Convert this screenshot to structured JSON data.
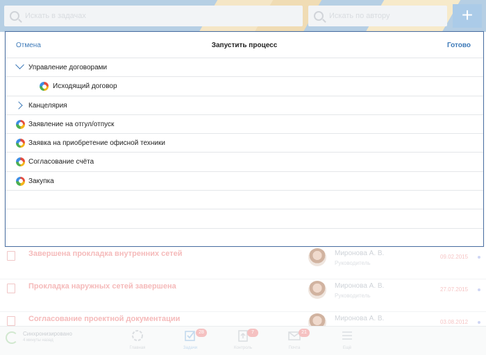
{
  "topbar": {
    "search_placeholder": "Искать в задачах",
    "filter_placeholder": "Искать по автору",
    "add_label": "+"
  },
  "modal": {
    "cancel_label": "Отмена",
    "title": "Запустить процесс",
    "done_label": "Готово",
    "items": [
      {
        "label": "Управление договорами",
        "kind": "group-expanded",
        "icon": "chevron-down-icon"
      },
      {
        "label": "Исходящий договор",
        "kind": "process",
        "icon": "process-ring-icon"
      },
      {
        "label": "Канцелярия",
        "kind": "group-collapsed",
        "icon": "chevron-right-icon"
      },
      {
        "label": "Заявление на отгул/отпуск",
        "kind": "process",
        "icon": "process-ring-icon"
      },
      {
        "label": "Заявка на приобретение офисной техники",
        "kind": "process",
        "icon": "process-ring-icon"
      },
      {
        "label": "Согласование счёта",
        "kind": "process",
        "icon": "process-ring-icon"
      },
      {
        "label": "Закупка",
        "kind": "process",
        "icon": "process-ring-icon"
      }
    ]
  },
  "tasks": [
    {
      "title": "Завершена прокладка внутренних сетей",
      "person": "Миронова А. В.",
      "role": "Руководитель",
      "date": "09.02.2015"
    },
    {
      "title": "Прокладка наружных сетей завершена",
      "person": "Миронова А. В.",
      "role": "Руководитель",
      "date": "27.07.2015"
    },
    {
      "title": "Согласование проектной документации",
      "person": "Миронова А. В.",
      "role": "Руководитель",
      "date": "03.08.2012"
    }
  ],
  "tabbar": {
    "sync_title": "Синхронизировано",
    "sync_subtitle": "4 минуты назад",
    "tabs": [
      {
        "label": "Главная",
        "badge": ""
      },
      {
        "label": "Задачи",
        "badge": "28"
      },
      {
        "label": "Контроль",
        "badge": "7"
      },
      {
        "label": "Почта",
        "badge": "21"
      },
      {
        "label": "Ещё",
        "badge": ""
      }
    ]
  },
  "colors": {
    "accent": "#3c79b8",
    "task_title": "#f09595",
    "badge": "#f0a0a0"
  }
}
